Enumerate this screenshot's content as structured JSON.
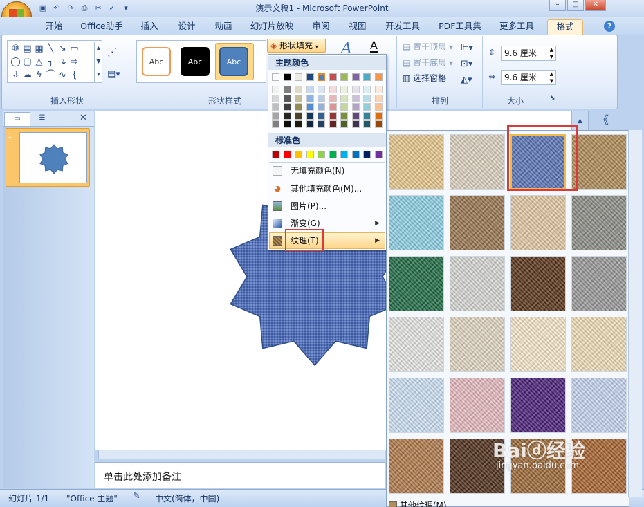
{
  "window": {
    "title": "演示文稿1 - Microsoft PowerPoint",
    "min_label": "–",
    "max_label": "□",
    "close_label": "✕"
  },
  "quick_access": {
    "items": [
      "save-icon",
      "undo-icon",
      "redo-icon",
      "print-preview-icon",
      "cut-icon",
      "check-icon",
      "dropdown-icon"
    ]
  },
  "tabs": [
    "开始",
    "Office助手",
    "插入",
    "设计",
    "动画",
    "幻灯片放映",
    "审阅",
    "视图",
    "开发工具",
    "PDF工具集",
    "更多工具",
    "格式"
  ],
  "active_tab": "格式",
  "help_label": "?",
  "ribbon": {
    "insert_shapes": {
      "label": "插入形状"
    },
    "shape_styles": {
      "label": "形状样式",
      "tiles": [
        "Abc",
        "Abc",
        "Abc"
      ],
      "fill_button": "形状填充"
    },
    "arrange": {
      "label": "排列",
      "bring_front": "置于顶层",
      "send_back": "置于底层",
      "selection_pane": "选择窗格"
    },
    "size": {
      "label": "大小",
      "height": "9.6 厘米",
      "width": "9.6 厘米"
    }
  },
  "fill_menu": {
    "theme_colors_header": "主题颜色",
    "standard_colors_header": "标准色",
    "theme_top": [
      "#ffffff",
      "#000000",
      "#eeece1",
      "#1f497d",
      "#4f81bd",
      "#c0504d",
      "#9bbb59",
      "#8064a2",
      "#4bacc6",
      "#f79646"
    ],
    "theme_shades": [
      [
        "#f2f2f2",
        "#7f7f7f",
        "#ddd9c3",
        "#c6d9f0",
        "#dbe5f1",
        "#f2dcdb",
        "#ebf1dd",
        "#e5e0ec",
        "#dbeef3",
        "#fdeada"
      ],
      [
        "#d8d8d8",
        "#595959",
        "#c4bd97",
        "#8db3e2",
        "#b8cce4",
        "#e5b9b7",
        "#d7e3bc",
        "#ccc1d9",
        "#b7dde8",
        "#fbd5b5"
      ],
      [
        "#bfbfbf",
        "#3f3f3f",
        "#938953",
        "#548dd4",
        "#95b3d7",
        "#d99694",
        "#c3d69b",
        "#b2a2c7",
        "#92cddc",
        "#fac08f"
      ],
      [
        "#a5a5a5",
        "#262626",
        "#494429",
        "#17365d",
        "#366092",
        "#953734",
        "#76923c",
        "#5f497a",
        "#31859b",
        "#e36c09"
      ],
      [
        "#7f7f7f",
        "#0c0c0c",
        "#1d1b10",
        "#0f243e",
        "#244061",
        "#632423",
        "#4f6128",
        "#3f3151",
        "#205867",
        "#974806"
      ]
    ],
    "standard": [
      "#c00000",
      "#ff0000",
      "#ffc000",
      "#ffff00",
      "#92d050",
      "#00b050",
      "#00b0f0",
      "#0070c0",
      "#002060",
      "#7030a0"
    ],
    "items": [
      {
        "label": "无填充颜色(N)",
        "icon": "no-fill-icon",
        "has_submenu": false
      },
      {
        "label": "其他填充颜色(M)...",
        "icon": "palette-icon",
        "has_submenu": false
      },
      {
        "label": "图片(P)...",
        "icon": "picture-icon",
        "has_submenu": false
      },
      {
        "label": "渐变(G)",
        "icon": "gradient-icon",
        "has_submenu": true
      },
      {
        "label": "纹理(T)",
        "icon": "texture-icon",
        "has_submenu": true
      }
    ],
    "highlighted_item": "纹理(T)"
  },
  "texture_gallery": {
    "selected_index": 2,
    "textures": [
      "papyrus",
      "canvas",
      "denim",
      "woven-mat",
      "water-droplets",
      "paper-bag",
      "fish-fossil",
      "sand",
      "green-marble",
      "white-marble",
      "brown-marble",
      "granite",
      "newsprint",
      "recycled-paper",
      "parchment",
      "stationery",
      "blue-tissue-paper",
      "pink-tissue-paper",
      "purple-mesh",
      "bouquet",
      "cork",
      "walnut",
      "oak",
      "medium-wood"
    ],
    "texture_colors": [
      "#e8c98d",
      "#ddd3c0",
      "#5a74b8",
      "#b08c57",
      "#8fd2e6",
      "#9a7650",
      "#e4c9a4",
      "#8e8e88",
      "#1f6b45",
      "#d8d8d6",
      "#5a3419",
      "#9a9a9a",
      "#e8e8e6",
      "#e3d8c3",
      "#f8e9cc",
      "#f1dfb8",
      "#cfe2f5",
      "#e8bcc1",
      "#4a1f7a",
      "#c7d6f1",
      "#b07a4a",
      "#4e2f1a",
      "#9c6835",
      "#a8632e"
    ],
    "more_textures_label": "其他纹理(M)..."
  },
  "slides_pane": {
    "tab1_icon": "slides-tab-icon",
    "tab2_icon": "outline-tab-icon",
    "close_label": "✕",
    "slide_number": "1"
  },
  "notes_placeholder": "单击此处添加备注",
  "status": {
    "slide_info": "幻灯片 1/1",
    "theme": "\"Office 主题\"",
    "language": "中文(简体，中国)"
  },
  "right_panel_toggle": "《",
  "watermark": {
    "brand": "Bai",
    "brand2": "经验",
    "url": "jingyan.baidu.com"
  }
}
